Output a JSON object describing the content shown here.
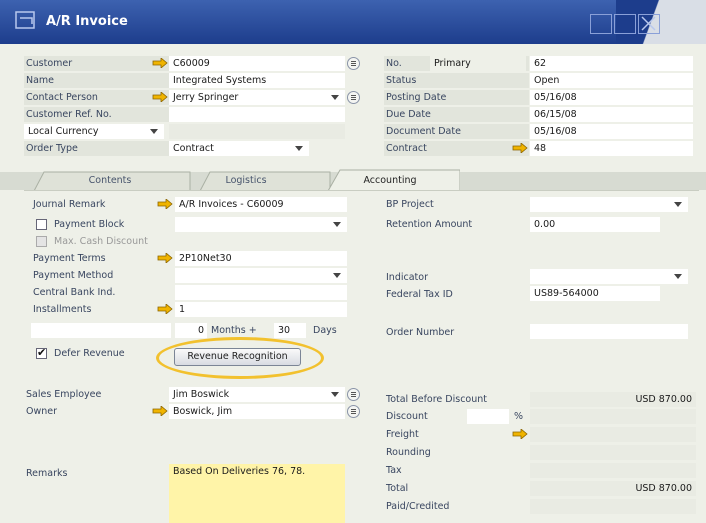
{
  "window": {
    "title": "A/R Invoice"
  },
  "header_left": {
    "customer_label": "Customer",
    "customer_value": "C60009",
    "name_label": "Name",
    "name_value": "Integrated Systems",
    "contact_label": "Contact Person",
    "contact_value": "Jerry Springer",
    "ref_label": "Customer Ref. No.",
    "ref_value": "",
    "currency_label": "Local Currency",
    "order_type_label": "Order Type",
    "order_type_value": "Contract"
  },
  "header_right": {
    "no_label": "No.",
    "no_series": "Primary",
    "no_value": "62",
    "status_label": "Status",
    "status_value": "Open",
    "posting_label": "Posting Date",
    "posting_value": "05/16/08",
    "due_label": "Due Date",
    "due_value": "06/15/08",
    "docdate_label": "Document Date",
    "docdate_value": "05/16/08",
    "contract_label": "Contract",
    "contract_value": "48"
  },
  "tabs": [
    {
      "label": "Contents"
    },
    {
      "label": "Logistics"
    },
    {
      "label": "Accounting"
    }
  ],
  "accounting": {
    "journal_label": "Journal Remark",
    "journal_value": "A/R Invoices - C60009",
    "payment_block_label": "Payment Block",
    "max_cash_label": "Max. Cash Discount",
    "terms_label": "Payment Terms",
    "terms_value": "2P10Net30",
    "method_label": "Payment Method",
    "bank_label": "Central Bank Ind.",
    "installments_label": "Installments",
    "installments_value": "1",
    "months_value": "0",
    "months_label": "Months +",
    "days_value": "30",
    "days_label": "Days",
    "defer_label": "Defer Revenue",
    "rev_button": "Revenue Recognition",
    "bp_project_label": "BP Project",
    "retention_label": "Retention Amount",
    "retention_value": "0.00",
    "indicator_label": "Indicator",
    "federal_label": "Federal Tax ID",
    "federal_value": "US89-564000",
    "order_number_label": "Order Number"
  },
  "footer_left": {
    "sales_label": "Sales Employee",
    "sales_value": "Jim Boswick",
    "owner_label": "Owner",
    "owner_value": "Boswick, Jim",
    "remarks_label": "Remarks",
    "remarks_value": "Based On Deliveries 76, 78."
  },
  "footer_right": {
    "total_before_label": "Total Before Discount",
    "total_before_value": "USD 870.00",
    "discount_label": "Discount",
    "discount_pct": "%",
    "freight_label": "Freight",
    "rounding_label": "Rounding",
    "tax_label": "Tax",
    "total_label": "Total",
    "total_value": "USD 870.00",
    "paid_label": "Paid/Credited"
  },
  "colors": {
    "titlebar": "#1d3d8c",
    "link_arrow": "#f0b400",
    "highlight_ring": "#f2c12e",
    "remarks_bg": "#fff4a8"
  },
  "icons": {
    "link": "orange-arrow-icon",
    "choose": "choose-from-list-icon",
    "dropdown": "chevron-down-icon"
  }
}
